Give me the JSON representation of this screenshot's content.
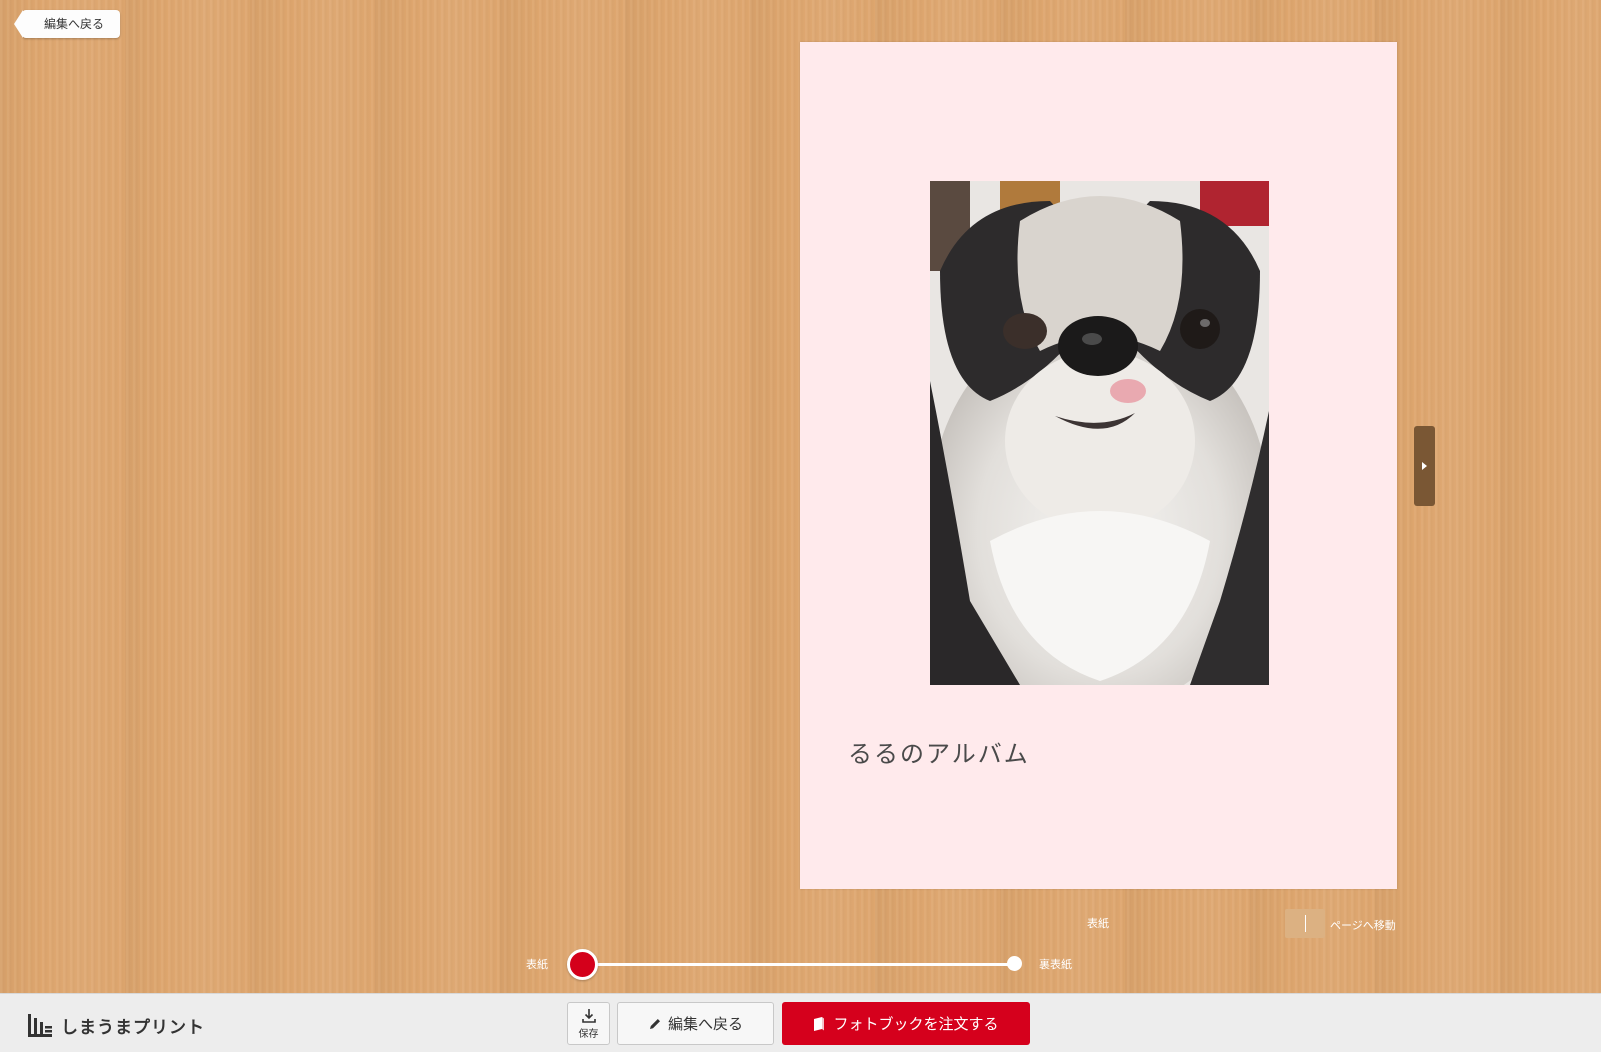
{
  "top": {
    "back_label": "編集へ戻る"
  },
  "book": {
    "title": "るるのアルバム",
    "current_page": "表紙"
  },
  "navigation": {
    "goto_label": "ページへ移動",
    "slider_start": "表紙",
    "slider_end": "裏表紙",
    "slider_position": 0
  },
  "toolbar": {
    "logo_text": "しまうまプリント",
    "save_label": "保存",
    "edit_label": "編集へ戻る",
    "order_label": "フォトブックを注文する"
  },
  "colors": {
    "background": "#dea66e",
    "page": "#ffeaec",
    "accent": "#d5001c"
  },
  "icons": [
    "back-arrow-icon",
    "next-page-icon",
    "save-download-icon",
    "pencil-icon",
    "book-icon",
    "logo-icon"
  ]
}
